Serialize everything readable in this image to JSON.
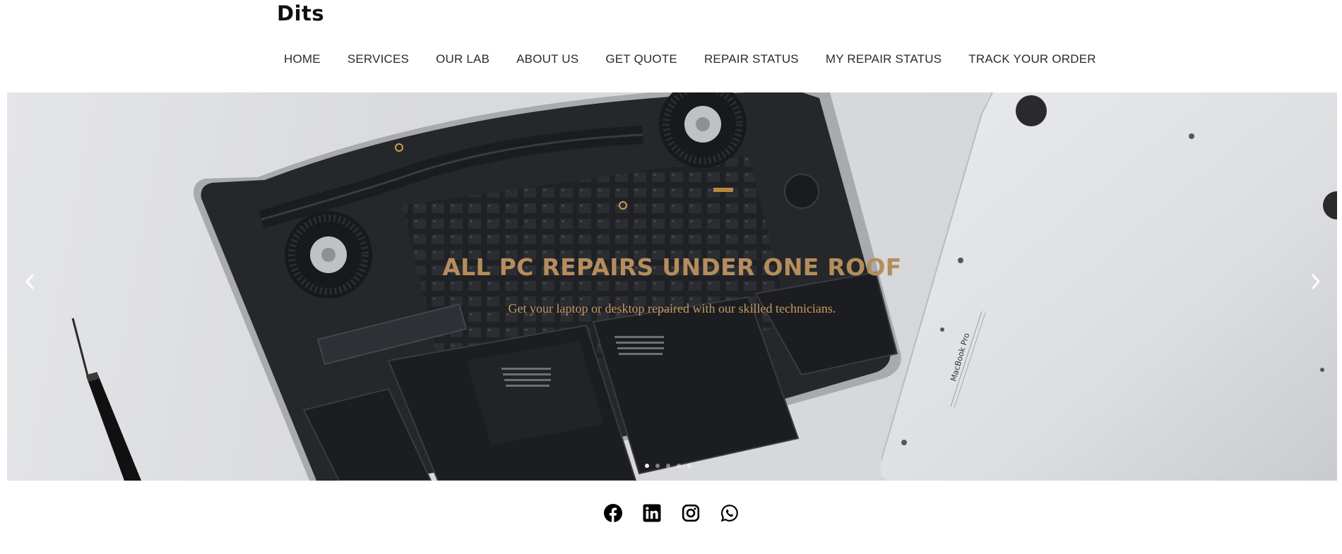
{
  "brand": {
    "logo": "Dits"
  },
  "nav": {
    "items": [
      {
        "label": "HOME"
      },
      {
        "label": "SERVICES"
      },
      {
        "label": "OUR LAB"
      },
      {
        "label": "ABOUT US"
      },
      {
        "label": "GET QUOTE"
      },
      {
        "label": "REPAIR STATUS"
      },
      {
        "label": "MY REPAIR STATUS"
      },
      {
        "label": "TRACK YOUR ORDER"
      }
    ]
  },
  "hero": {
    "title": "ALL PC REPAIRS UNDER ONE ROOF",
    "subtitle": "Get your laptop or desktop repaired with our skilled technicians.",
    "laptop_text": "MacBook Pro",
    "slide_count": 5,
    "active_slide": 1,
    "prev_icon": "chevron-left-icon",
    "next_icon": "chevron-right-icon"
  },
  "social": {
    "icons": [
      "facebook-icon",
      "linkedin-icon",
      "instagram-icon",
      "whatsapp-icon"
    ]
  },
  "colors": {
    "title": "#b58d5c",
    "subtitle": "#c59a65",
    "nav_text": "#2a2a2a"
  }
}
